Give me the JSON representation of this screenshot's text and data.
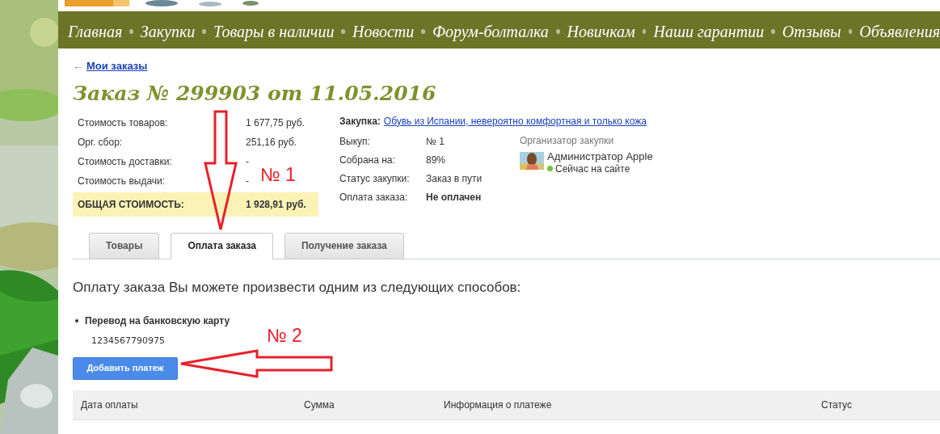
{
  "nav": {
    "items": [
      "Главная",
      "Закупки",
      "Товары в наличии",
      "Новости",
      "Форум-болталка",
      "Новичкам",
      "Наши гарантии",
      "Отзывы",
      "Объявления"
    ]
  },
  "back_link": {
    "arrow": "←",
    "label": "Мои заказы"
  },
  "title": "Заказ № 299903 от 11.05.2016",
  "costs": [
    {
      "label": "Стоимость товаров:",
      "value": "1 677,75 руб."
    },
    {
      "label": "Орг. сбор:",
      "value": "251,16 руб."
    },
    {
      "label": "Стоимость доставки:",
      "value": "-"
    },
    {
      "label": "Стоимость выдачи:",
      "value": "-"
    }
  ],
  "total": {
    "label": "ОБЩАЯ СТОИМОСТЬ:",
    "value": "1 928,91 руб."
  },
  "purchase": {
    "label": "Закупка:",
    "link": "Обувь из Испании, невероятно комфортная и только кожа"
  },
  "details": [
    {
      "label": "Выкуп:",
      "value": "№ 1",
      "bold": false
    },
    {
      "label": "Собрана на:",
      "value": "89%",
      "bold": false
    },
    {
      "label": "Статус закупки:",
      "value": "Заказ в пути",
      "bold": false
    },
    {
      "label": "Оплата заказа:",
      "value": "Не оплачен",
      "bold": true
    }
  ],
  "organizer": {
    "heading": "Организатор закупки",
    "name": "Администратор Apple",
    "online": true,
    "status": "Сейчас на сайте"
  },
  "tabs": [
    {
      "label": "Товары",
      "selected": false
    },
    {
      "label": "Оплата заказа",
      "selected": true
    },
    {
      "label": "Получение заказа",
      "selected": false
    }
  ],
  "payment": {
    "intro": "Оплату заказа Вы можете произвести одним из следующих способов:",
    "methods": [
      {
        "title": "Перевод на банковскую карту",
        "number": "1234567790975"
      }
    ],
    "button": "Добавить платеж"
  },
  "table": {
    "columns": [
      "Дата оплаты",
      "Сумма",
      "Информация о платеже",
      "Статус"
    ]
  },
  "annotations": [
    {
      "label": "№ 1",
      "kind": "down"
    },
    {
      "label": "№ 2",
      "kind": "left"
    }
  ]
}
